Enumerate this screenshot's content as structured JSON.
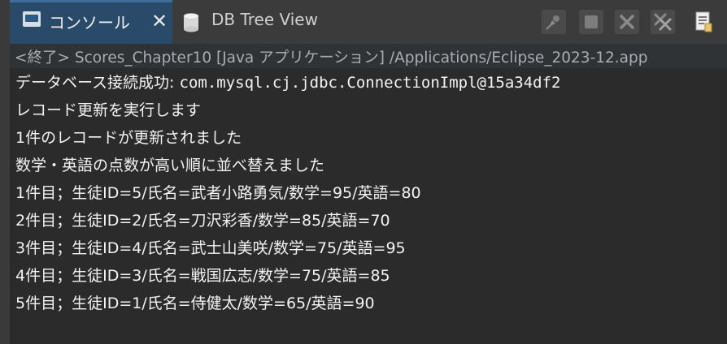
{
  "tabs": {
    "console_label": "コンソール",
    "close_glyph": "✕",
    "db_tree_label": "DB Tree View"
  },
  "launch": {
    "text": "<終了> Scores_Chapter10 [Java アプリケーション] /Applications/Eclipse_2023-12.app"
  },
  "console": {
    "line1_prefix": "データベース接続成功: ",
    "line1_code": "com.mysql.cj.jdbc.ConnectionImpl@15a34df2",
    "lines": [
      "レコード更新を実行します",
      "1件のレコードが更新されました",
      "数学・英語の点数が高い順に並べ替えました",
      "1件目；生徒ID=5/氏名=武者小路勇気/数学=95/英語=80",
      "2件目；生徒ID=2/氏名=刀沢彩香/数学=85/英語=70",
      "3件目；生徒ID=4/氏名=武士山美咲/数学=75/英語=95",
      "4件目；生徒ID=3/氏名=戦国広志/数学=75/英語=85",
      "5件目；生徒ID=1/氏名=侍健太/数学=65/英語=90"
    ]
  },
  "icons": {
    "console": "console-icon",
    "db": "database-icon",
    "pin": "pin-icon",
    "terminate": "terminate-icon",
    "remove": "remove-launch-icon",
    "remove_all": "remove-all-icon",
    "clipboard": "clipboard-icon"
  }
}
